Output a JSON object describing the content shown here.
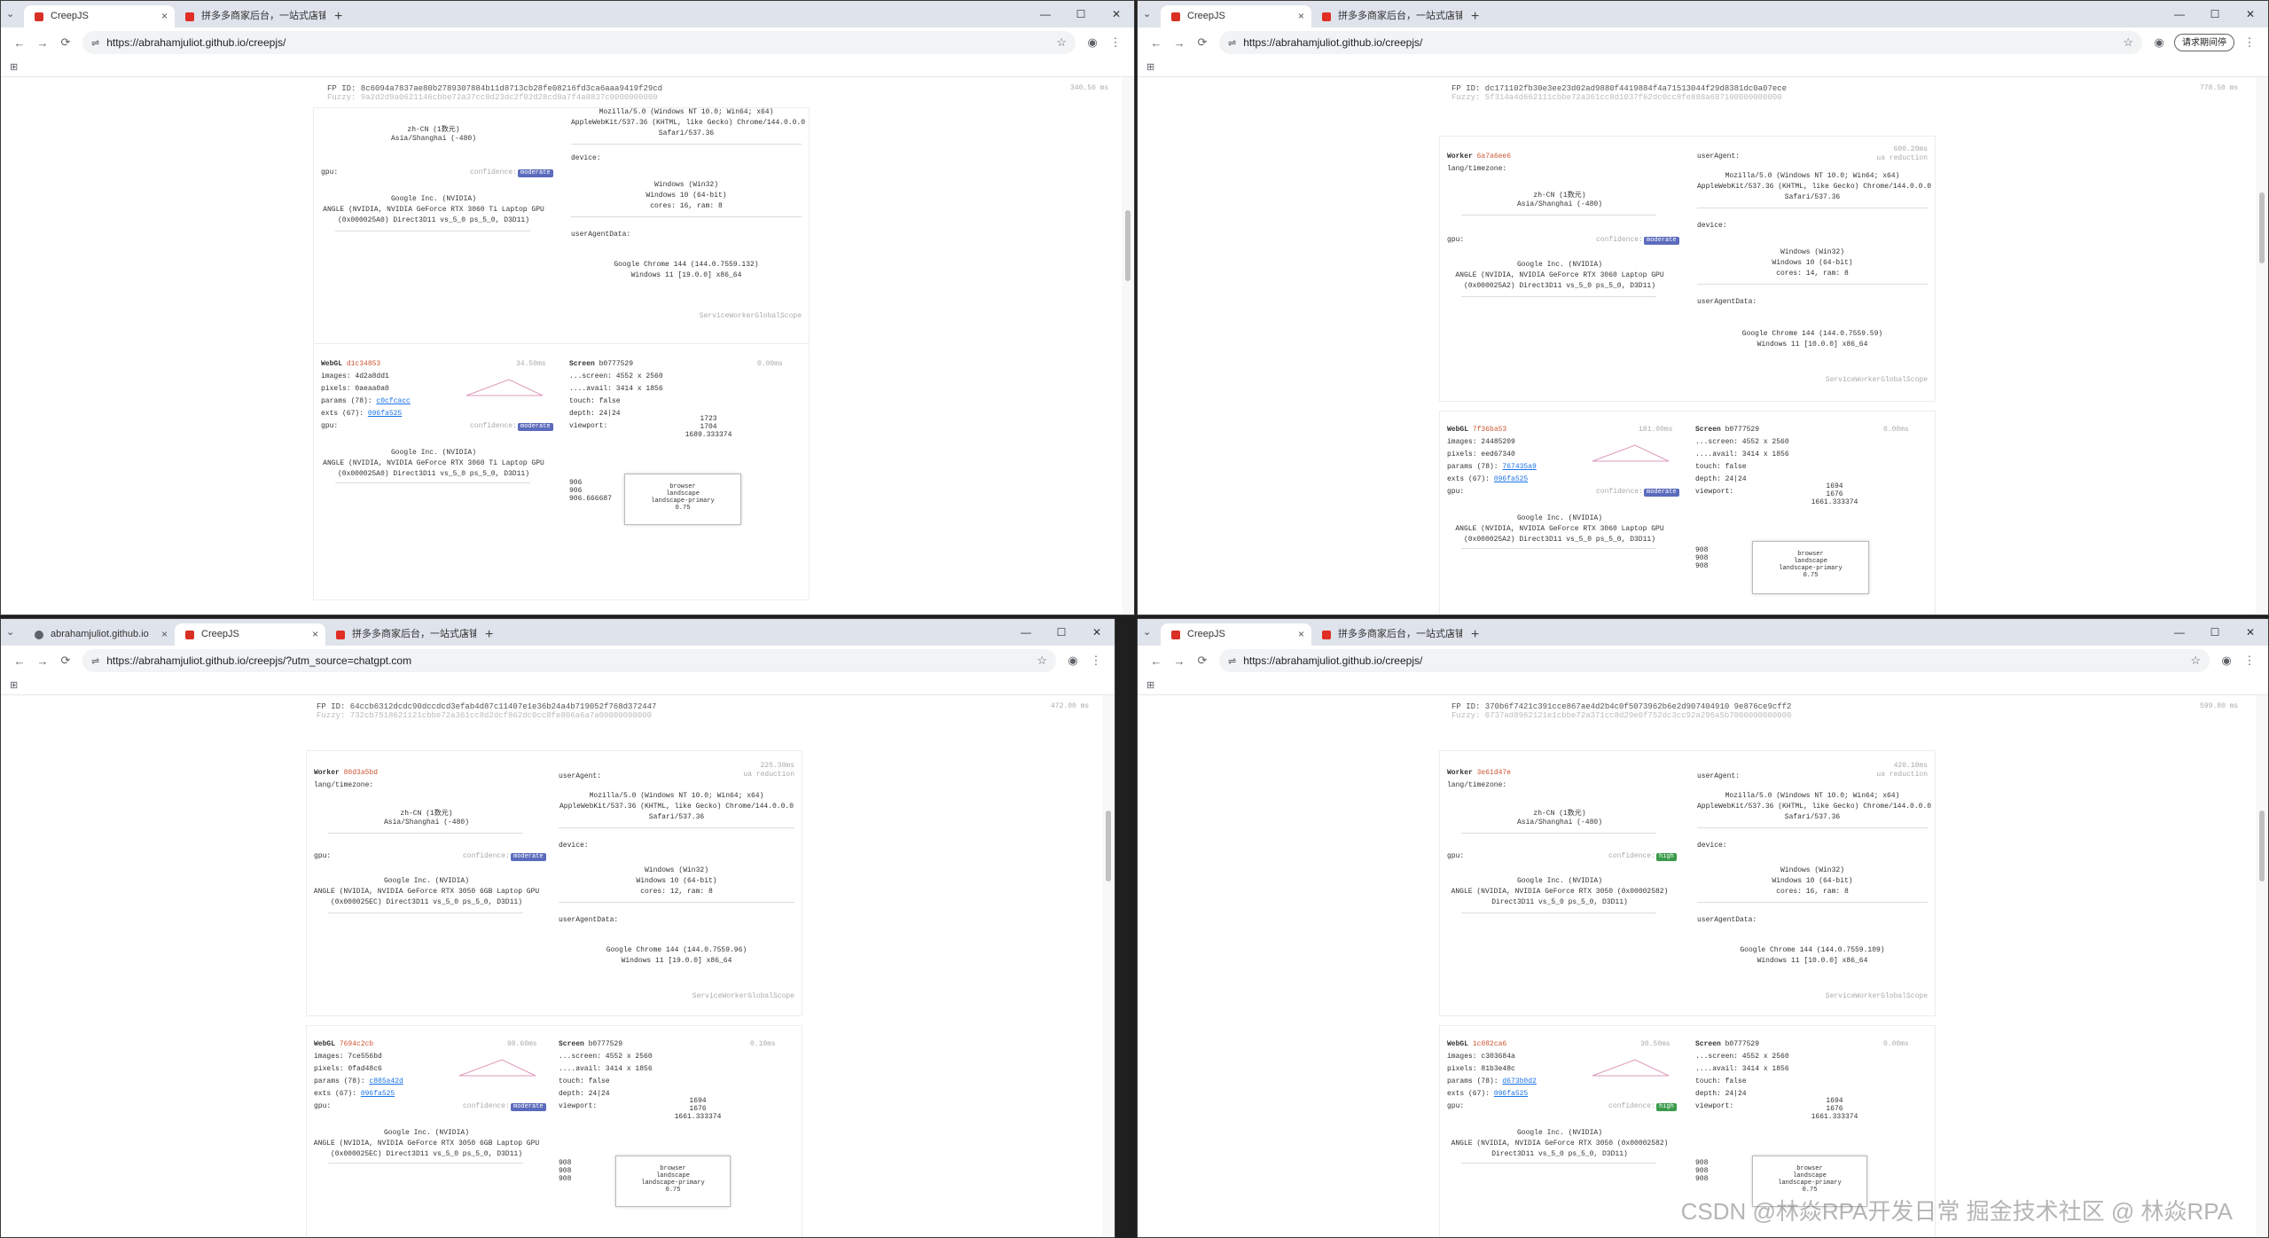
{
  "common": {
    "url": "https://abrahamjuliot.github.io/creepjs/",
    "tab_creepjs": "CreepJS",
    "tab_pdd": "拼多多商家后台，一站式店铺管理",
    "tab_abraham": "abrahamjuliot.github.io",
    "update_button": "请求期间停",
    "icons": {
      "back": "←",
      "forward": "→",
      "reload": "⟳",
      "star": "☆",
      "menu": "⋮",
      "min": "—",
      "max": "☐",
      "close": "✕",
      "apps": "⊞",
      "tune": "⇌",
      "profile": "◉",
      "newtab": "+",
      "tabclose": "×",
      "dropdown": "⌄"
    }
  },
  "w1": {
    "fp_id": "FP ID: 8c6094a7837ae80b2789307884b11d8713cb28fe08216fd3ca6aaa9419f29cd",
    "fuzzy": "Fuzzy: 9a2d2d9a0621146cbbe72a37cc8d23dc2f02d28cd8a7f4a8837c0000000000",
    "ms": "340.50 ms",
    "lang": "zh-CN (1数元)",
    "tz": "Asia/Shanghai (-480)",
    "ua1": "Mozilla/5.0 (Windows NT 10.0; Win64; x64)",
    "ua2": "AppleWebKit/537.36 (KHTML, like Gecko) Chrome/144.0.0.0",
    "ua3": "Safari/537.36",
    "gpu_label": "gpu:",
    "confidence": "confidence:",
    "badge": "moderate",
    "gpu1": "Google Inc. (NVIDIA)",
    "gpu2": "ANGLE (NVIDIA, NVIDIA GeForce RTX 3060 Ti Laptop GPU",
    "gpu3": "(0x000025A0) Direct3D11 vs_5_0 ps_5_0, D3D11)",
    "device": "device:",
    "dev1": "Windows (Win32)",
    "dev2": "Windows 10 (64-bit)",
    "dev3": "cores: 16, ram: 8",
    "uad": "userAgentData:",
    "uad1": "Google Chrome 144 (144.0.7559.132)",
    "uad2": "Windows 11 [19.0.0] x86_64",
    "scope": "ServiceWorkerGlobalScope",
    "webgl": "WebGL",
    "webgl_hash": "d1c34853",
    "webgl_ms": "34.50ms",
    "images": "images:",
    "images_hash": "4d2a8dd1",
    "pixels": "pixels:",
    "pixels_hash": "0aeaa0a0",
    "params": "params (78):",
    "params_hash": "c0cfcacc",
    "exts": "exts (67):",
    "exts_hash": "096fa525",
    "screen": "Screen",
    "screen_hash": "b0777529",
    "screen_ms": "0.00ms",
    "scr1": "...screen: 4552 x 2560",
    "scr2": "....avail: 3414 x 1856",
    "touch": "touch: false",
    "depth": "depth: 24|24",
    "viewport": "viewport:",
    "vp1": "1723",
    "vp2": "1704",
    "vp3": "1689.333374",
    "vl1": "906",
    "vl2": "906",
    "vl3": "906.666687",
    "box1": "browser",
    "box2": "landscape",
    "box3": "landscape-primary",
    "box4": "0.75"
  },
  "w2": {
    "fp_id": "FP ID: dc171102fb30e3ee23d02ad9880f4419884f4a71513044f29d8381dc0a07ece",
    "fuzzy": "Fuzzy: 5f314a4d662111cbbe72a361cc8d1037f62dc0cc8fe888a687100000000000",
    "ms": "778.50 ms",
    "worker": "Worker",
    "worker_hash": "6a7a6ee6",
    "worker_ms": "600.20ms",
    "noreduction": "ua reduction",
    "lang_tz": "lang/timezone:",
    "lang": "zh-CN (1数元)",
    "tz": "Asia/Shanghai (-480)",
    "ua_label": "userAgent:",
    "ua1": "Mozilla/5.0 (Windows NT 10.0; Win64; x64)",
    "ua2": "AppleWebKit/537.36 (KHTML, like Gecko) Chrome/144.0.0.0",
    "ua3": "Safari/537.36",
    "gpu_label": "gpu:",
    "confidence": "confidence:",
    "badge": "moderate",
    "gpu1": "Google Inc. (NVIDIA)",
    "gpu2": "ANGLE (NVIDIA, NVIDIA GeForce RTX 3060 Laptop GPU",
    "gpu3": "(0x000025A2) Direct3D11 vs_5_0 ps_5_0, D3D11)",
    "device": "device:",
    "dev1": "Windows (Win32)",
    "dev2": "Windows 10 (64-bit)",
    "dev3": "cores: 14, ram: 8",
    "uad": "userAgentData:",
    "uad1": "Google Chrome 144 (144.0.7559.59)",
    "uad2": "Windows 11 [10.0.0] x86_64",
    "scope": "ServiceWorkerGlobalScope",
    "webgl": "WebGL",
    "webgl_hash": "7f36ba53",
    "webgl_ms": "181.00ms",
    "images": "images:",
    "images_hash": "24485209",
    "pixels": "pixels:",
    "pixels_hash": "eed67340",
    "params": "params (78):",
    "params_hash": "767435a9",
    "exts": "exts (67):",
    "exts_hash": "096fa525",
    "screen": "Screen",
    "screen_hash": "b0777529",
    "screen_ms": "0.00ms",
    "scr1": "...screen: 4552 x 2560",
    "scr2": "....avail: 3414 x 1856",
    "touch": "touch: false",
    "depth": "depth: 24|24",
    "viewport": "viewport:",
    "vp1": "1694",
    "vp2": "1676",
    "vp3": "1661.333374",
    "vl1": "908",
    "vl2": "908",
    "vl3": "908",
    "box1": "browser",
    "box2": "landscape",
    "box3": "landscape-primary",
    "box4": "0.75"
  },
  "w3": {
    "url": "https://abrahamjuliot.github.io/creepjs/?utm_source=chatgpt.com",
    "fp_id": "FP ID: 64ccb6312dcdc90dccdcd3efab4d87c11407e1e36b24a4b719052f768d372447",
    "fuzzy": "Fuzzy: 732cb7518621121cbbe72a361cc8d2dcf862dc0cc8fe806a6a7a00000000000",
    "ms": "472.00 ms",
    "worker": "Worker",
    "worker_hash": "80d3a5bd",
    "worker_ms": "225.30ms",
    "noreduction": "ua reduction",
    "lang_tz": "lang/timezone:",
    "lang": "zh-CN (1数元)",
    "tz": "Asia/Shanghai (-480)",
    "ua_label": "userAgent:",
    "ua1": "Mozilla/5.0 (Windows NT 10.0; Win64; x64)",
    "ua2": "AppleWebKit/537.36 (KHTML, like Gecko) Chrome/144.0.0.0",
    "ua3": "Safari/537.36",
    "gpu_label": "gpu:",
    "confidence": "confidence:",
    "badge": "moderate",
    "gpu1": "Google Inc. (NVIDIA)",
    "gpu2": "ANGLE (NVIDIA, NVIDIA GeForce RTX 3050 6GB Laptop GPU",
    "gpu3": "(0x000025EC) Direct3D11 vs_5_0 ps_5_0, D3D11)",
    "device": "device:",
    "dev1": "Windows (Win32)",
    "dev2": "Windows 10 (64-bit)",
    "dev3": "cores: 12, ram: 8",
    "uad": "userAgentData:",
    "uad1": "Google Chrome 144 (144.0.7559.96)",
    "uad2": "Windows 11 [19.0.0] x86_64",
    "scope": "ServiceWorkerGlobalScope",
    "webgl": "WebGL",
    "webgl_hash": "7694c2cb",
    "webgl_ms": "98.60ms",
    "images": "images:",
    "images_hash": "7ce556bd",
    "pixels": "pixels:",
    "pixels_hash": "0fad48c6",
    "params": "params (78):",
    "params_hash": "c885a42d",
    "exts": "exts (67):",
    "exts_hash": "096fa525",
    "screen": "Screen",
    "screen_hash": "b0777529",
    "screen_ms": "0.10ms",
    "scr1": "...screen: 4552 x 2560",
    "scr2": "....avail: 3414 x 1856",
    "touch": "touch: false",
    "depth": "depth: 24|24",
    "viewport": "viewport:",
    "vp1": "1694",
    "vp2": "1676",
    "vp3": "1661.333374",
    "vl1": "908",
    "vl2": "908",
    "vl3": "908",
    "box1": "browser",
    "box2": "landscape",
    "box3": "landscape-primary",
    "box4": "0.75"
  },
  "w4": {
    "fp_id": "FP ID: 370b6f7421c391cce867ae4d2b4c0f5073962b6e2d907404910 9e876ce9cff2",
    "fuzzy": "Fuzzy: 0737ad8962121e1cbbe72a371cc8d29e0f752dc3cc92a296a5b7000000000000",
    "ms": "599.80 ms",
    "worker": "Worker",
    "worker_hash": "3e61d47e",
    "worker_ms": "420.10ms",
    "noreduction": "ua reduction",
    "lang_tz": "lang/timezone:",
    "lang": "zh-CN (1数元)",
    "tz": "Asia/Shanghai (-480)",
    "ua_label": "userAgent:",
    "ua1": "Mozilla/5.0 (Windows NT 10.0; Win64; x64)",
    "ua2": "AppleWebKit/537.36 (KHTML, like Gecko) Chrome/144.0.0.0",
    "ua3": "Safari/537.36",
    "gpu_label": "gpu:",
    "confidence": "confidence:",
    "badge": "high",
    "gpu1": "Google Inc. (NVIDIA)",
    "gpu2": "ANGLE (NVIDIA, NVIDIA GeForce RTX 3050 (0x00002582)",
    "gpu3": "Direct3D11 vs_5_0 ps_5_0, D3D11)",
    "device": "device:",
    "dev1": "Windows (Win32)",
    "dev2": "Windows 10 (64-bit)",
    "dev3": "cores: 16, ram: 8",
    "uad": "userAgentData:",
    "uad1": "Google Chrome 144 (144.0.7559.109)",
    "uad2": "Windows 11 [10.0.0] x86_64",
    "scope": "ServiceWorkerGlobalScope",
    "webgl": "WebGL",
    "webgl_hash": "1c082ca6",
    "webgl_ms": "30.50ms",
    "images": "images:",
    "images_hash": "c303684a",
    "pixels": "pixels:",
    "pixels_hash": "81b3e48c",
    "params": "params (78):",
    "params_hash": "d673b0d2",
    "exts": "exts (67):",
    "exts_hash": "096fa525",
    "screen": "Screen",
    "screen_hash": "b0777529",
    "screen_ms": "0.00ms",
    "scr1": "...screen: 4552 x 2560",
    "scr2": "....avail: 3414 x 1856",
    "touch": "touch: false",
    "depth": "depth: 24|24",
    "viewport": "viewport:",
    "vp1": "1694",
    "vp2": "1676",
    "vp3": "1661.333374",
    "vl1": "908",
    "vl2": "908",
    "vl3": "908",
    "box1": "browser",
    "box2": "landscape",
    "box3": "landscape-primary",
    "box4": "0.75"
  },
  "watermark": "CSDN @林焱RPA开发日常   掘金技术社区 @ 林焱RPA"
}
